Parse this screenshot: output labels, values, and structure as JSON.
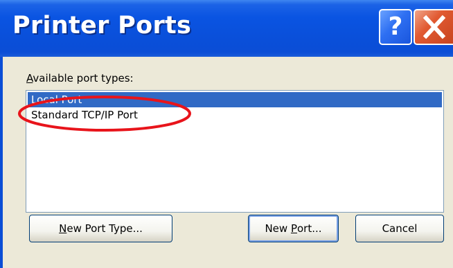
{
  "window": {
    "title": "Printer Ports",
    "help_glyph": "?"
  },
  "dialog": {
    "label_mnemonic": "A",
    "label_rest": "vailable port types:",
    "port_types": [
      {
        "label": "Local Port",
        "selected": true
      },
      {
        "label": "Standard TCP/IP Port",
        "selected": false
      }
    ]
  },
  "buttons": {
    "new_port_type_mn": "N",
    "new_port_type_rest": "ew Port Type...",
    "new_port_pre": "New ",
    "new_port_mn": "P",
    "new_port_rest": "ort...",
    "cancel": "Cancel"
  },
  "colors": {
    "titlebar": "#0a54e2",
    "selection": "#316ac5",
    "annotation_ellipse": "#e8141b",
    "close_button": "#e15a32",
    "dialog_face": "#ece9d8"
  },
  "icons": {
    "help": "help-icon",
    "close": "close-icon"
  }
}
